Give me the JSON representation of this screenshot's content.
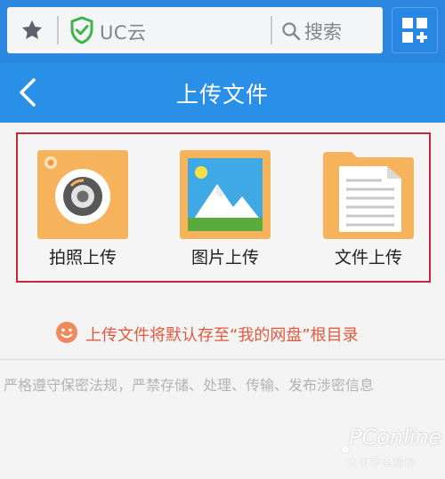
{
  "browser": {
    "url_text": "UC云",
    "search_label": "搜索",
    "icons": {
      "favorite": "star-icon",
      "security": "shield-check-icon",
      "search": "search-icon",
      "menu": "grid-plus-icon"
    },
    "colors": {
      "bar": "#2c86e0",
      "shield": "#3fb24b"
    }
  },
  "header": {
    "title": "上传文件",
    "back_icon": "chevron-left-icon"
  },
  "upload_options": [
    {
      "label": "拍照上传",
      "icon": "camera-icon"
    },
    {
      "label": "图片上传",
      "icon": "picture-icon"
    },
    {
      "label": "文件上传",
      "icon": "document-folder-icon"
    }
  ],
  "notice": {
    "text": "上传文件将默认存至“我的网盘”根目录",
    "icon": "smile-icon",
    "color": "#e05a40"
  },
  "policy_text": "严格遵守保密法规，严禁存储、处理、传输、发布涉密信息",
  "watermark": {
    "brand": "PConline",
    "sub": "太平洋电脑网"
  }
}
